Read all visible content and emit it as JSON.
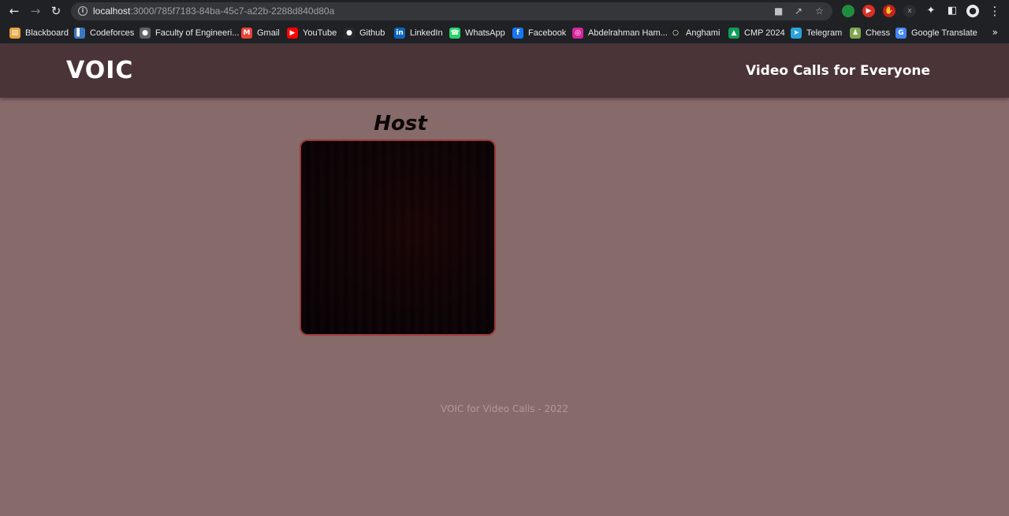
{
  "browser": {
    "url_host": "localhost",
    "url_rest": ":3000/785f7183-84ba-45c7-a22b-2288d840d80a",
    "bookmarks": [
      {
        "label": "Blackboard",
        "icon": "blackboard-icon",
        "color": "#e8a33d"
      },
      {
        "label": "Codeforces",
        "icon": "codeforces-icon",
        "color": "#3b78c4"
      },
      {
        "label": "Faculty of Engineeri...",
        "icon": "globe-icon",
        "color": "#5f6368"
      },
      {
        "label": "Gmail",
        "icon": "gmail-icon",
        "color": "#ea4335"
      },
      {
        "label": "YouTube",
        "icon": "youtube-icon",
        "color": "#ff0000"
      },
      {
        "label": "Github",
        "icon": "github-icon",
        "color": "#24292e"
      },
      {
        "label": "LinkedIn",
        "icon": "linkedin-icon",
        "color": "#0a66c2"
      },
      {
        "label": "WhatsApp",
        "icon": "whatsapp-icon",
        "color": "#25d366"
      },
      {
        "label": "Facebook",
        "icon": "facebook-icon",
        "color": "#1877f2"
      },
      {
        "label": "Abdelrahman Ham...",
        "icon": "instagram-icon",
        "color": "#d6249f"
      },
      {
        "label": "Anghami",
        "icon": "anghami-icon",
        "color": "#1f1f1f"
      },
      {
        "label": "CMP 2024",
        "icon": "drive-icon",
        "color": "#0f9d58"
      },
      {
        "label": "Telegram",
        "icon": "telegram-icon",
        "color": "#2aa3dd"
      },
      {
        "label": "Chess",
        "icon": "chess-icon",
        "color": "#7fa650"
      },
      {
        "label": "Google Translate",
        "icon": "translate-icon",
        "color": "#4285f4"
      }
    ],
    "more_label": "»"
  },
  "header": {
    "brand": "VOIC",
    "tagline": "Video Calls for Everyone"
  },
  "main": {
    "host_label": "Host"
  },
  "footer": {
    "text": "VOIC for Video Calls - 2022"
  }
}
